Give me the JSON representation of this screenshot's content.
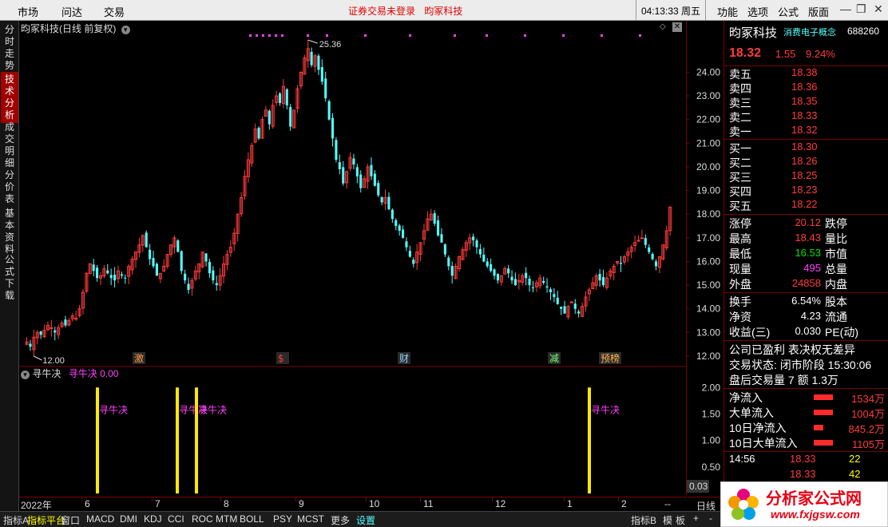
{
  "menu": {
    "items": [
      "市场",
      "问达",
      "交易"
    ],
    "status_text": "证券交易未登录",
    "stock_name_link": "昀冢科技",
    "clock": "04:13:33",
    "weekday": "周五",
    "right_items": [
      "功能",
      "选项",
      "公式",
      "版面"
    ]
  },
  "left_tabs": [
    {
      "label": "分时走势",
      "active": false
    },
    {
      "label": "技术分析",
      "active": true
    },
    {
      "label": "成交明细",
      "active": false
    },
    {
      "label": "分价表",
      "active": false
    },
    {
      "label": "基本资料",
      "active": false
    },
    {
      "label": "公式下载",
      "active": false
    }
  ],
  "chart_header": {
    "title": "昀冢科技(日线 前复权)"
  },
  "indicator_header": {
    "name": "寻牛决",
    "label": "寻牛决",
    "value": "0.00"
  },
  "chart_data": [
    {
      "type": "candlestick",
      "title": "昀冢科技(日线 前复权)",
      "y_ticks": [
        "24.00",
        "23.00",
        "22.00",
        "21.00",
        "20.00",
        "19.00",
        "18.00",
        "17.00",
        "16.00",
        "15.00",
        "14.00",
        "13.00",
        "12.00"
      ],
      "ylim": [
        12.0,
        25.5
      ],
      "x_tick_labels": [
        "2022年",
        "6",
        "7",
        "8",
        "9",
        "10",
        "11",
        "12",
        "1",
        "2"
      ],
      "annotations": {
        "high": "25.36",
        "low": "12.00"
      },
      "event_markers": [
        "激",
        "$",
        "财",
        "减",
        "预榜"
      ],
      "colors": {
        "up": "#ff3b3b",
        "down": "#54ffff",
        "marker": "#ff40ff"
      },
      "closes": [
        12.6,
        12.4,
        12.8,
        13.0,
        12.9,
        13.1,
        13.3,
        13.2,
        13.0,
        13.2,
        13.4,
        13.3,
        13.5,
        13.7,
        13.6,
        14.0,
        14.7,
        15.5,
        15.9,
        15.6,
        15.3,
        15.4,
        15.7,
        15.5,
        15.3,
        15.2,
        15.6,
        15.4,
        15.3,
        15.8,
        16.1,
        16.4,
        16.7,
        17.1,
        16.6,
        16.1,
        15.8,
        15.4,
        15.5,
        15.8,
        16.3,
        16.7,
        17.0,
        16.4,
        15.6,
        15.2,
        14.8,
        15.2,
        15.6,
        15.9,
        16.4,
        16.0,
        15.5,
        15.2,
        15.0,
        15.4,
        15.9,
        16.3,
        16.6,
        17.2,
        18.0,
        18.7,
        19.6,
        20.3,
        20.9,
        21.6,
        21.2,
        22.0,
        22.4,
        21.8,
        22.6,
        23.0,
        22.7,
        23.4,
        22.6,
        21.7,
        22.4,
        23.3,
        24.0,
        24.6,
        25.0,
        24.3,
        24.7,
        24.1,
        23.6,
        22.9,
        22.0,
        21.2,
        20.3,
        19.9,
        19.3,
        19.8,
        20.4,
        20.1,
        19.6,
        19.1,
        19.5,
        20.0,
        19.6,
        19.2,
        18.8,
        18.5,
        18.7,
        18.2,
        17.8,
        17.5,
        17.3,
        17.0,
        16.6,
        16.2,
        15.9,
        16.4,
        16.8,
        17.3,
        17.8,
        18.0,
        17.6,
        17.1,
        16.8,
        16.3,
        15.8,
        15.4,
        15.8,
        16.2,
        16.5,
        16.8,
        17.0,
        16.9,
        16.6,
        16.3,
        16.0,
        15.8,
        15.6,
        15.4,
        15.2,
        15.4,
        15.7,
        15.5,
        15.2,
        15.0,
        15.2,
        15.4,
        15.3,
        15.0,
        14.9,
        15.1,
        15.3,
        15.1,
        14.9,
        14.7,
        14.5,
        14.2,
        14.0,
        13.8,
        14.1,
        14.3,
        14.0,
        13.8,
        14.1,
        14.5,
        14.8,
        15.1,
        15.4,
        15.2,
        15.0,
        15.3,
        15.6,
        15.8,
        16.0,
        15.9,
        16.2,
        16.4,
        16.6,
        16.8,
        16.9,
        17.0,
        16.7,
        16.4,
        16.1,
        15.8,
        16.2,
        16.7,
        17.3,
        18.3
      ]
    },
    {
      "type": "bar",
      "title": "寻牛决",
      "y_ticks": [
        "2.00",
        "1.50",
        "1.00",
        "0.50",
        "0.03"
      ],
      "ylim": [
        0.0,
        2.2
      ],
      "signals": [
        {
          "x_frac": 0.11,
          "value": 2.0,
          "label": "寻牛决"
        },
        {
          "x_frac": 0.235,
          "value": 2.0,
          "label": "寻牛决"
        },
        {
          "x_frac": 0.265,
          "value": 2.0,
          "label": "寻牛决"
        },
        {
          "x_frac": 0.88,
          "value": 2.0,
          "label": "寻牛决"
        }
      ]
    }
  ],
  "right_panel": {
    "stock_name": "昀冢科技",
    "concept": "消费电子概念",
    "code": "688260",
    "price": "18.32",
    "change": "1.55",
    "change_pct": "9.24%",
    "sells": [
      {
        "label": "卖五",
        "price": "18.38"
      },
      {
        "label": "卖四",
        "price": "18.36"
      },
      {
        "label": "卖三",
        "price": "18.35"
      },
      {
        "label": "卖二",
        "price": "18.33"
      },
      {
        "label": "卖一",
        "price": "18.32"
      }
    ],
    "buys": [
      {
        "label": "买一",
        "price": "18.30"
      },
      {
        "label": "买二",
        "price": "18.26"
      },
      {
        "label": "买三",
        "price": "18.25"
      },
      {
        "label": "买四",
        "price": "18.23"
      },
      {
        "label": "买五",
        "price": "18.22"
      }
    ],
    "stats1": [
      {
        "label": "涨停",
        "value": "20.12",
        "label2": "跌停",
        "color": "#ff3b3b"
      },
      {
        "label": "最高",
        "value": "18.43",
        "label2": "量比",
        "color": "#ff3b3b"
      },
      {
        "label": "最低",
        "value": "16.53",
        "label2": "市值",
        "color": "#00e000"
      },
      {
        "label": "现量",
        "value": "495",
        "label2": "总量",
        "color": "#ff40ff"
      },
      {
        "label": "外盘",
        "value": "24858",
        "label2": "内盘",
        "color": "#ff3b3b"
      }
    ],
    "stats2": [
      {
        "label": "换手",
        "value": "6.54%",
        "label2": "股本"
      },
      {
        "label": "净资",
        "value": "4.23",
        "label2": "流通"
      },
      {
        "label": "收益(三)",
        "value": "0.030",
        "label2": "PE(动)"
      }
    ],
    "info_lines": [
      "公司已盈利 表决权无差异",
      "交易状态: 闭市阶段 15:30:06",
      "盘后交易量 7 额 1.3万"
    ],
    "flows": [
      {
        "label": "净流入",
        "value": "1534万"
      },
      {
        "label": "大单流入",
        "value": "1004万"
      },
      {
        "label": "10日净流入",
        "value": "845.2万"
      },
      {
        "label": "10日大单流入",
        "value": "1105万"
      }
    ],
    "ticks": [
      {
        "time": "14:56",
        "price": "18.33",
        "vol": "22"
      },
      {
        "time": "",
        "price": "18.33",
        "vol": "42"
      }
    ]
  },
  "bottom_tabs": [
    "指标A",
    "指标平台",
    "窗口",
    "MACD",
    "DMI",
    "KDJ",
    "CCI",
    "ROC",
    "MTM",
    "BOLL",
    "PSY",
    "MCST",
    "更多",
    "设置"
  ],
  "bottom_right": [
    "指标B",
    "模",
    "板"
  ],
  "period": "日线",
  "logo": {
    "text": "分析家公式网",
    "url": "www.fxjgsw.com"
  }
}
